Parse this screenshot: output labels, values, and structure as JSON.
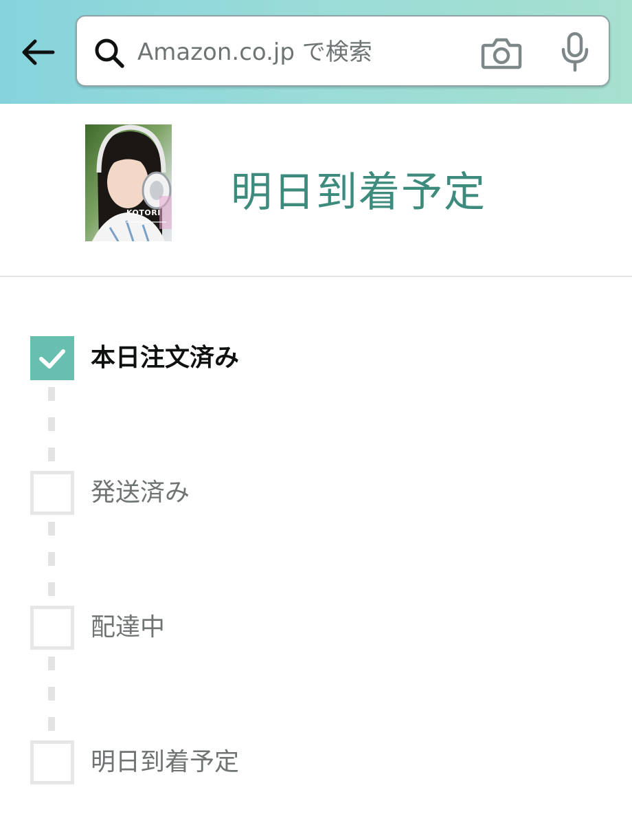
{
  "colors": {
    "header_gradient_start": "#86d3dc",
    "header_gradient_end": "#a6e0cf",
    "delivery_status": "#3c8b7c",
    "step_checked": "#66bfaf",
    "step_unchecked_border": "#e6e6e6"
  },
  "header": {
    "back_icon": "arrow-left-icon",
    "search": {
      "placeholder": "Amazon.co.jp で検索",
      "value": "",
      "search_icon": "search-icon",
      "camera_icon": "camera-icon",
      "mic_icon": "microphone-icon"
    }
  },
  "product": {
    "thumbnail_caption": "KOTORI",
    "delivery_status": "明日到着予定"
  },
  "tracker": {
    "steps": [
      {
        "label": "本日注文済み",
        "completed": true
      },
      {
        "label": "発送済み",
        "completed": false
      },
      {
        "label": "配達中",
        "completed": false
      },
      {
        "label": "明日到着予定",
        "completed": false
      }
    ]
  }
}
